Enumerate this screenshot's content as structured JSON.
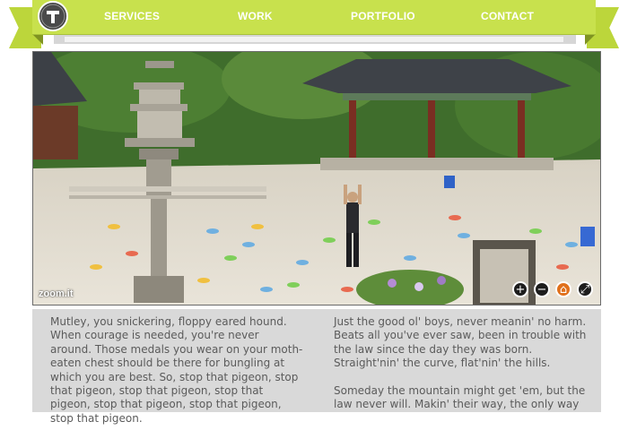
{
  "nav": {
    "items": [
      "SERVICES",
      "WORK",
      "PORTFOLIO",
      "CONTACT"
    ],
    "accent": "#c8e14d",
    "logo_icon": "coin-t-logo-icon"
  },
  "viewer": {
    "watermark": "zoom.it",
    "controls": [
      {
        "name": "zoom-in-icon",
        "glyph": "+"
      },
      {
        "name": "zoom-out-icon",
        "glyph": "−"
      },
      {
        "name": "home-icon",
        "glyph": "⌂"
      },
      {
        "name": "fullscreen-icon",
        "glyph": "⤢"
      }
    ]
  },
  "text": {
    "left_paragraph": "Mutley, you snickering, floppy eared hound. When courage is needed, you're never around. Those medals you wear on your moth-eaten chest should be there for bungling at which you are best. So, stop that pigeon, stop that pigeon, stop that pigeon, stop that pigeon, stop that pigeon, stop that pigeon, stop that pigeon.",
    "right_paragraph_1": "Just the good ol' boys, never meanin' no harm. Beats all you've ever saw, been in trouble with the law since the day they was born. Straight'nin' the curve, flat'nin' the hills.",
    "right_paragraph_2": "Someday the mountain might get 'em, but the law never will. Makin' their way, the only way"
  }
}
